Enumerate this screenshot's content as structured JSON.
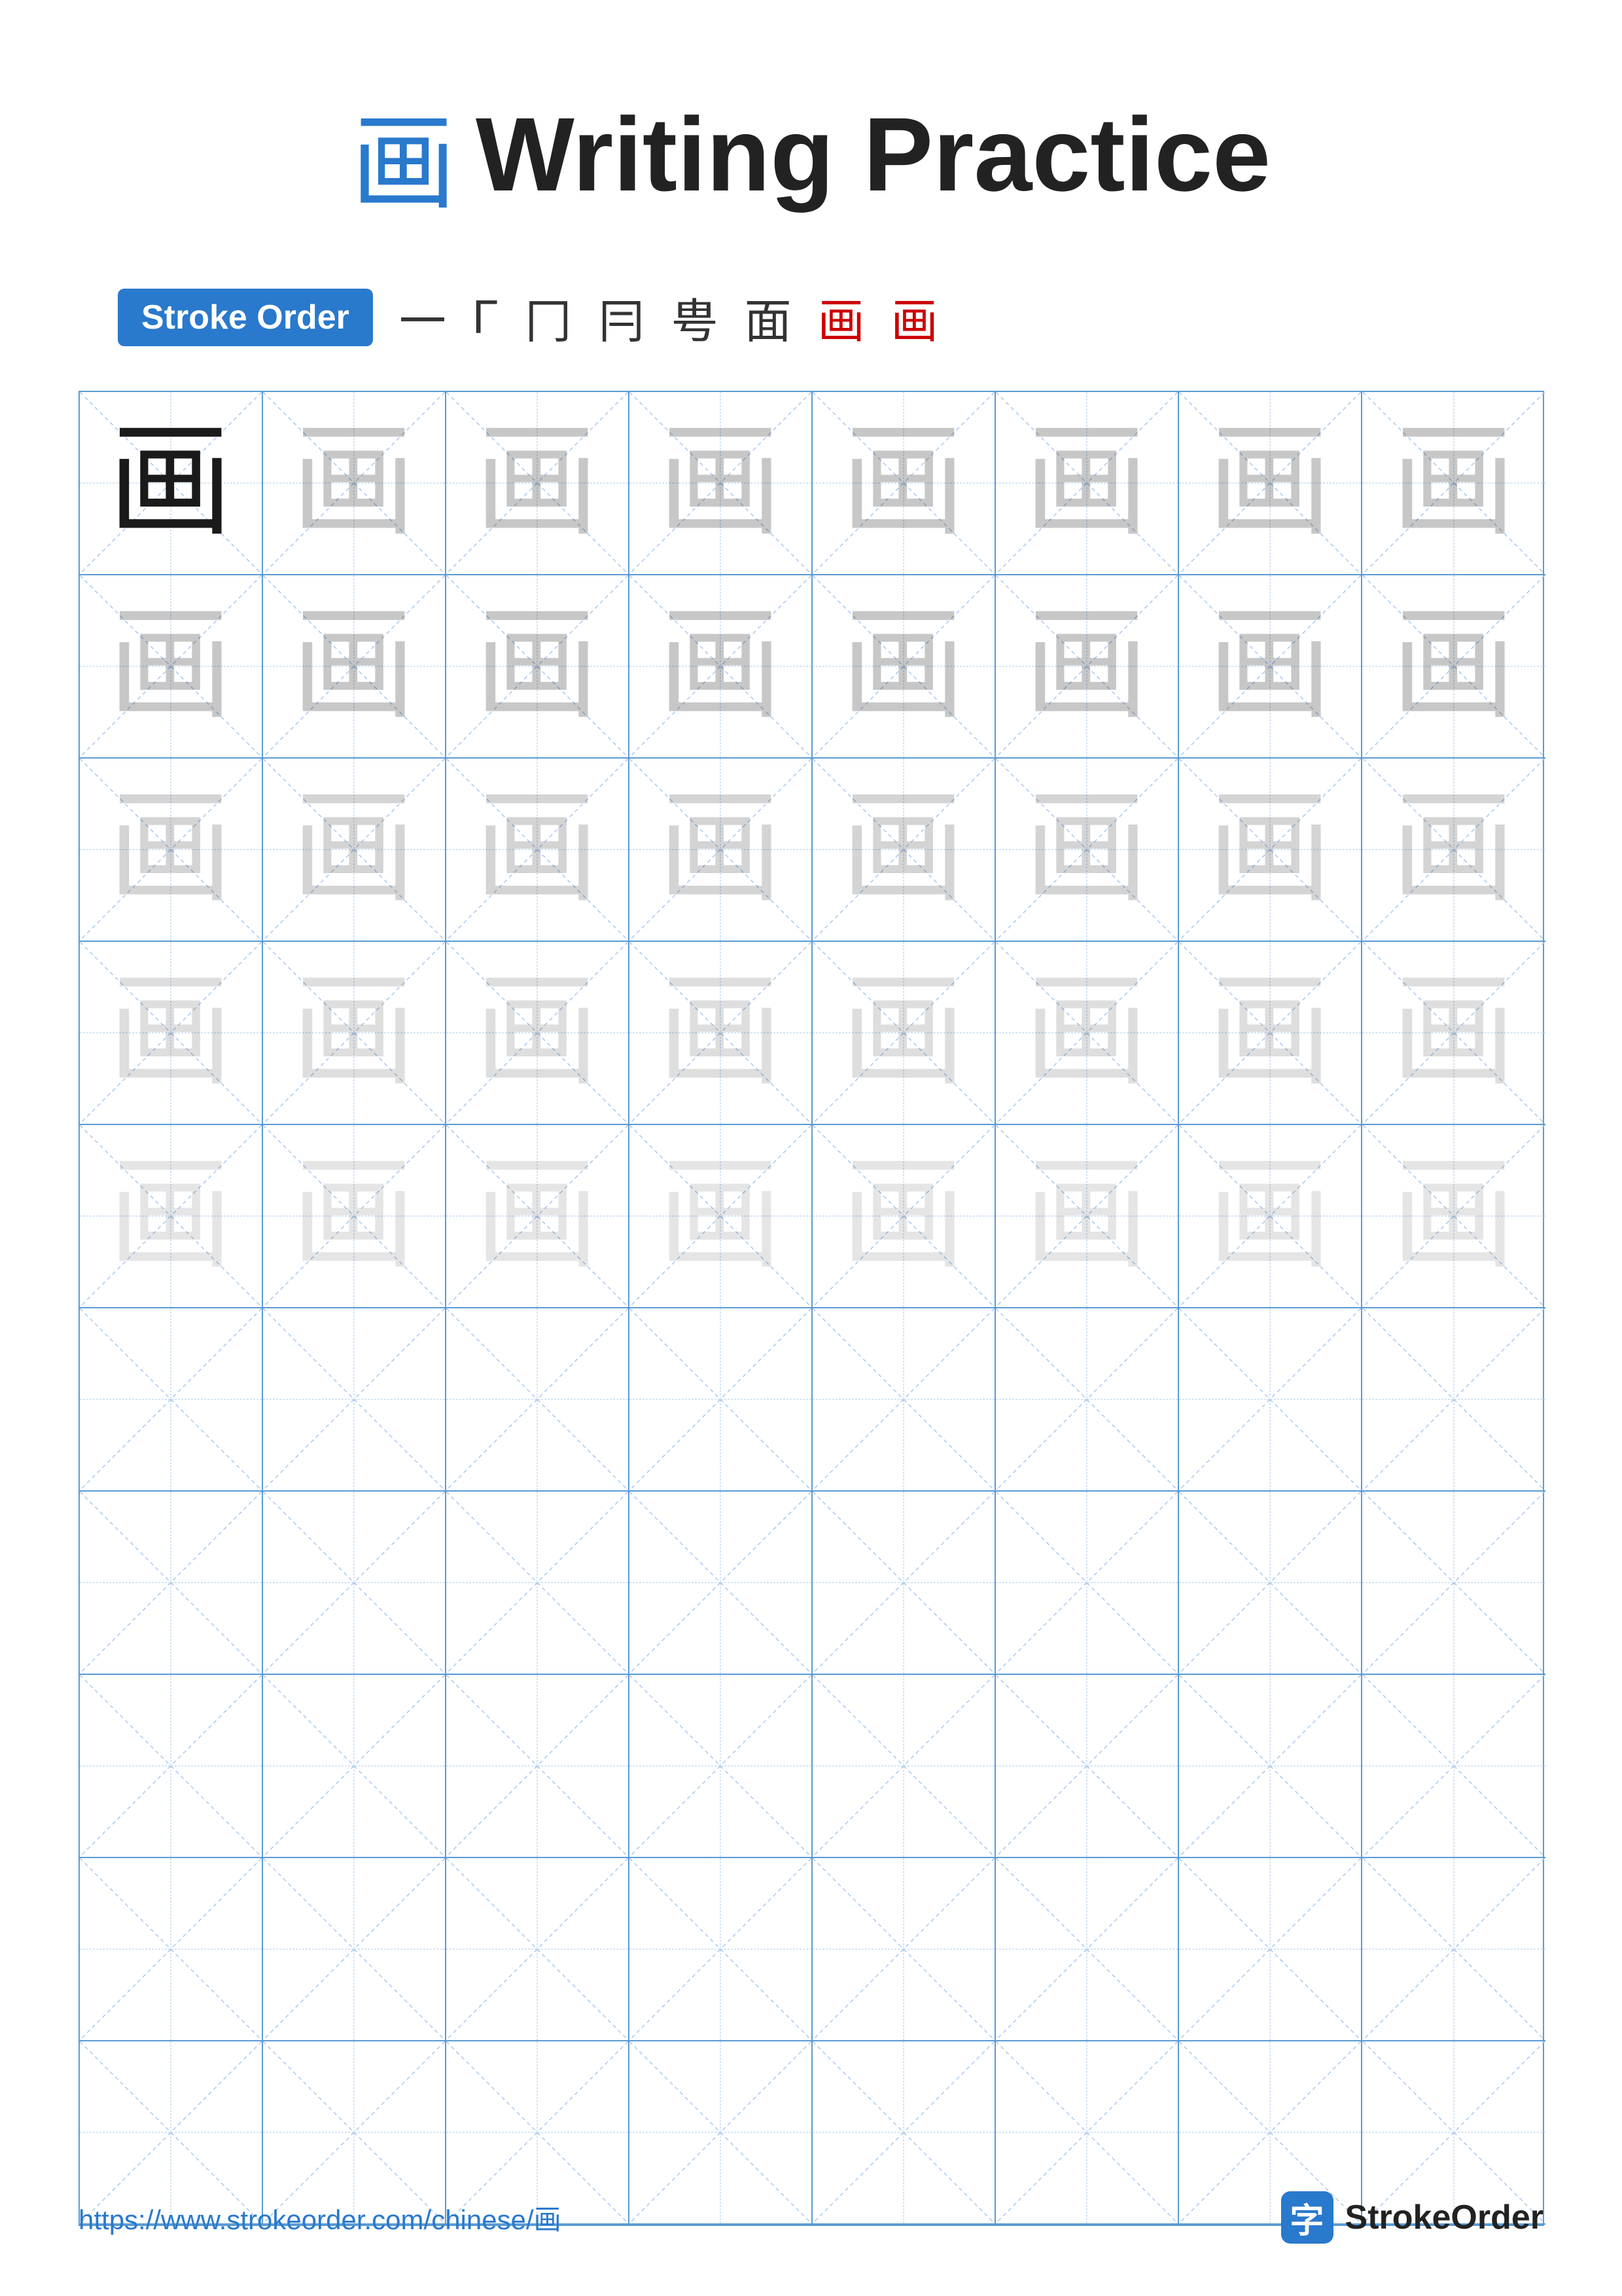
{
  "title": {
    "char": "画",
    "text": "Writing Practice"
  },
  "stroke_order": {
    "badge_label": "Stroke Order",
    "steps": [
      "一",
      "Γ",
      "冂",
      "冃",
      "甹",
      "面",
      "画",
      "画"
    ]
  },
  "grid": {
    "cols": 8,
    "rows": 10,
    "char": "画",
    "guide_color": "#a8c8ee",
    "border_color": "#5b9bd5"
  },
  "footer": {
    "url": "https://www.strokeorder.com/chinese/画",
    "brand_icon": "字",
    "brand_name": "StrokeOrder"
  }
}
